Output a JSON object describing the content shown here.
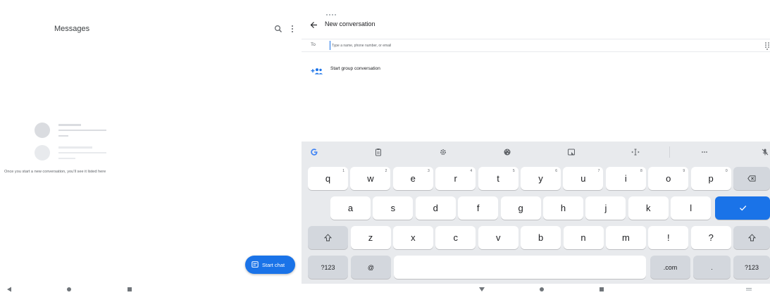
{
  "left": {
    "title": "Messages",
    "empty_text": "Once you start a new conversation, you’ll see it listed here",
    "start_chat_label": "Start chat"
  },
  "right": {
    "title": "New conversation",
    "to_label": "To",
    "to_placeholder": "Type a name, phone number, or email",
    "group_label": "Start group conversation"
  },
  "keyboard": {
    "row1": [
      {
        "label": "q",
        "sup": "1"
      },
      {
        "label": "w",
        "sup": "2"
      },
      {
        "label": "e",
        "sup": "3"
      },
      {
        "label": "r",
        "sup": "4"
      },
      {
        "label": "t",
        "sup": "5"
      },
      {
        "label": "y",
        "sup": "6"
      },
      {
        "label": "u",
        "sup": "7"
      },
      {
        "label": "i",
        "sup": "8"
      },
      {
        "label": "o",
        "sup": "9"
      },
      {
        "label": "p",
        "sup": "0"
      }
    ],
    "row2": [
      "a",
      "s",
      "d",
      "f",
      "g",
      "h",
      "j",
      "k",
      "l"
    ],
    "row3": [
      "z",
      "x",
      "c",
      "v",
      "b",
      "n",
      "m",
      "!",
      "?"
    ],
    "row4": {
      "symbols": "?123",
      "at": "@",
      "dotcom": ".com",
      "period": ".",
      "symbols_right": "?123"
    },
    "toolbar_icons": [
      "google-icon",
      "clipboard-icon",
      "settings-icon",
      "palette-icon",
      "sticker-icon",
      "text-cursor-icon",
      "more-icon",
      "mic-off-icon"
    ]
  },
  "colors": {
    "accent": "#1a73e8",
    "keyboard_bg": "#e8eaed",
    "function_key": "#d3d7dd"
  }
}
